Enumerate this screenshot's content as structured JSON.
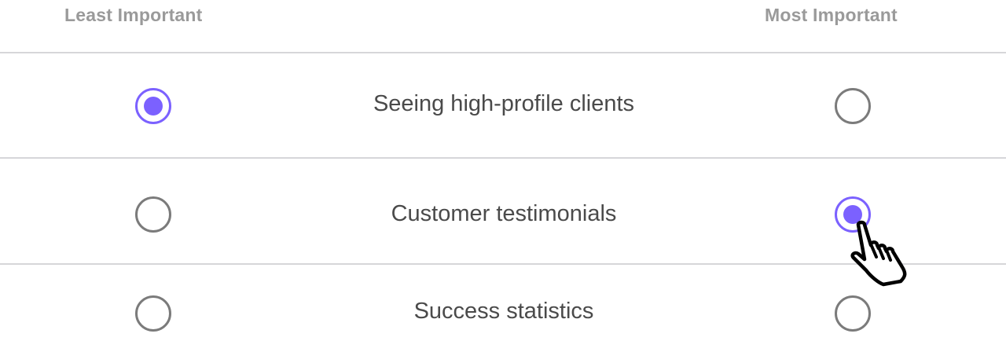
{
  "header": {
    "least_label": "Least Important",
    "most_label": "Most Important"
  },
  "rows": [
    {
      "label": "Seeing high-profile clients",
      "selected": "least"
    },
    {
      "label": "Customer testimonials",
      "selected": "most"
    },
    {
      "label": "Success statistics",
      "selected": "none"
    }
  ],
  "colors": {
    "accent": "#7b61ff",
    "unselected_border": "#7b7b7b",
    "header_text": "#9a9a9a",
    "body_text": "#4a4a4a",
    "divider": "#d6d6d9"
  },
  "cursor_icon": "hand-pointer-icon"
}
